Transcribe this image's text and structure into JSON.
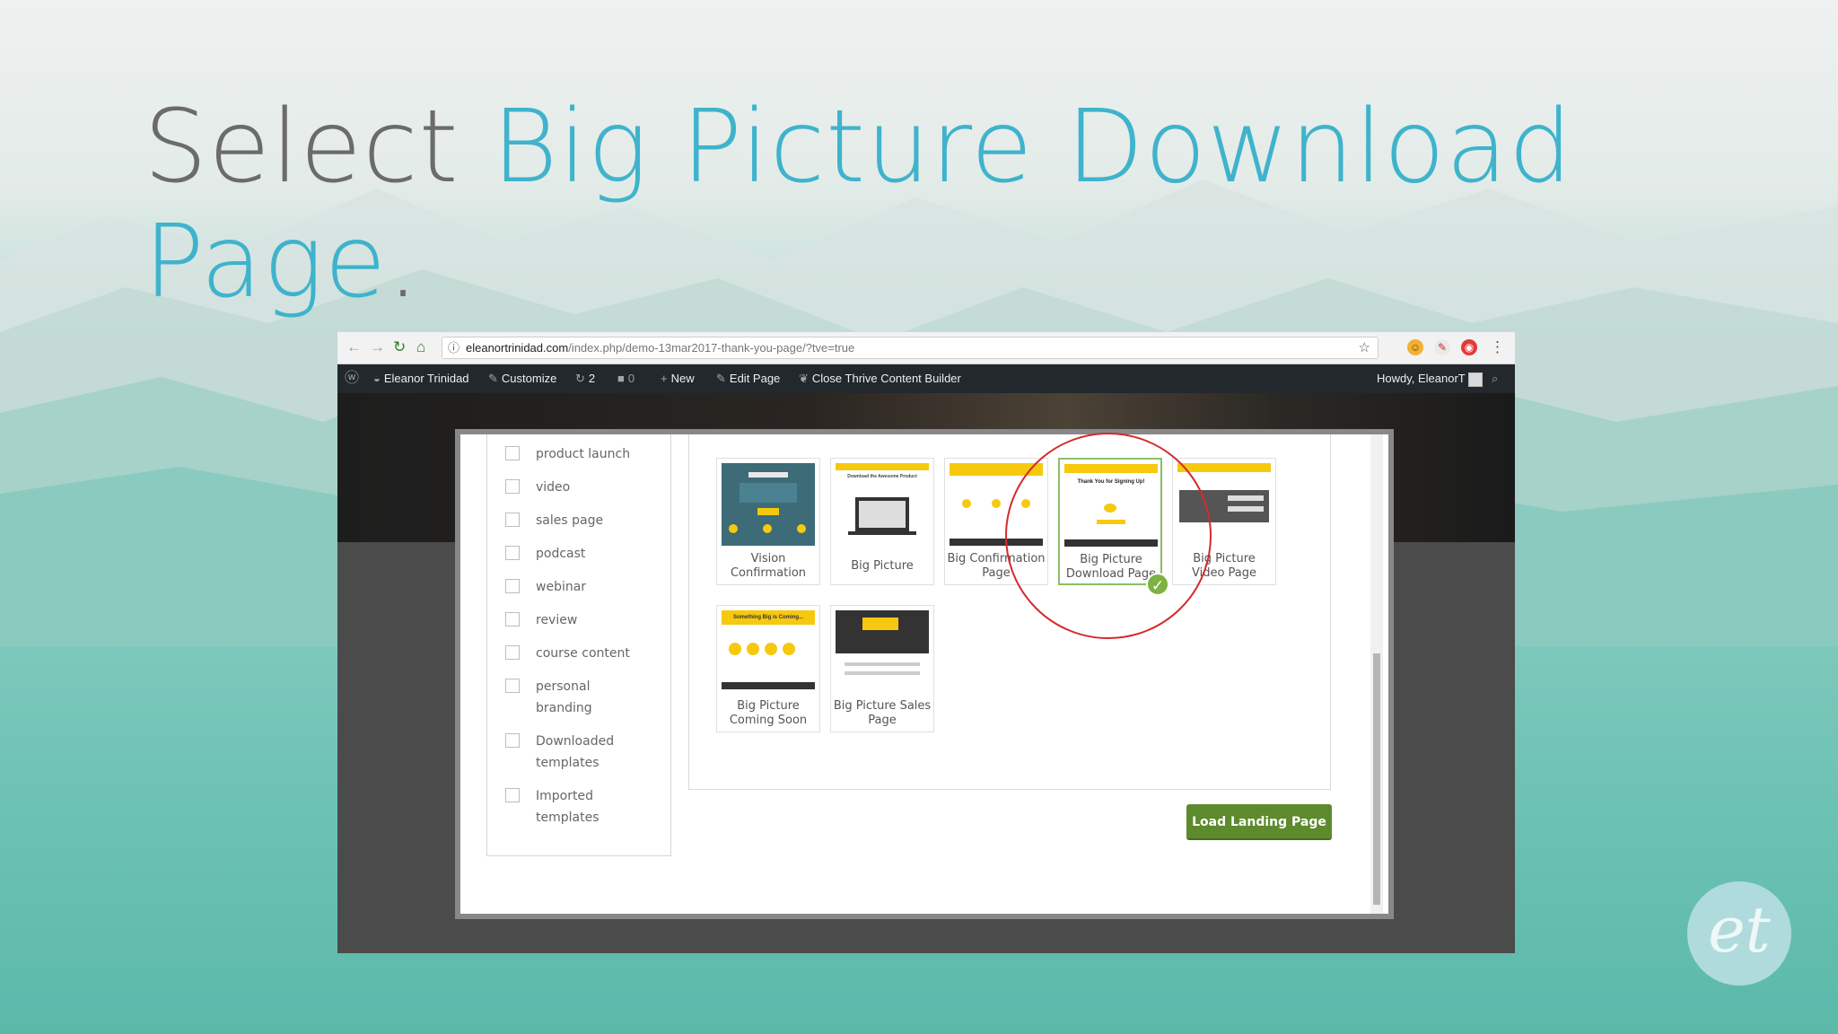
{
  "slide_title": {
    "prefix": "Select",
    "highlight_line1": "Big Picture Download",
    "highlight_line2": "Page",
    "suffix": "."
  },
  "browser": {
    "url_domain": "eleanortrinidad.com",
    "url_path": "/index.php/demo-13mar2017-thank-you-page/?tve=true"
  },
  "admin_bar": {
    "site_name": "Eleanor Trinidad",
    "customize": "Customize",
    "updates_count": "2",
    "comments_count": "0",
    "new_label": "New",
    "edit_page": "Edit Page",
    "close_builder": "Close Thrive Content Builder",
    "howdy": "Howdy, EleanorT"
  },
  "categories": [
    {
      "label": "product launch"
    },
    {
      "label": "video"
    },
    {
      "label": "sales page"
    },
    {
      "label": "podcast"
    },
    {
      "label": "webinar"
    },
    {
      "label": "review"
    },
    {
      "label": "course content"
    },
    {
      "label": "personal branding"
    },
    {
      "label": "Downloaded templates"
    },
    {
      "label": "Imported templates"
    }
  ],
  "templates": [
    {
      "name": "Vision Confirmation",
      "selected": false
    },
    {
      "name": "Big Picture",
      "selected": false
    },
    {
      "name": "Big Confirmation Page",
      "selected": false
    },
    {
      "name": "Big Picture Download Page",
      "selected": true
    },
    {
      "name": "Big Picture Video Page",
      "selected": false
    },
    {
      "name": "Big Picture Coming Soon",
      "selected": false
    },
    {
      "name": "Big Picture Sales Page",
      "selected": false
    }
  ],
  "thumb_texts": {
    "download": "Thank You for Signing Up!",
    "coming": "Something Big is Coming...",
    "big_picture": "Download the Awesome Product"
  },
  "load_button": "Load Landing Page",
  "logo_text": "et",
  "colors": {
    "title_gray": "#6b6b6b",
    "title_blue": "#3fb3cc",
    "accent_yellow": "#f6c90e",
    "button_green": "#5d8a2d",
    "highlight_circle": "#d42b2b"
  }
}
